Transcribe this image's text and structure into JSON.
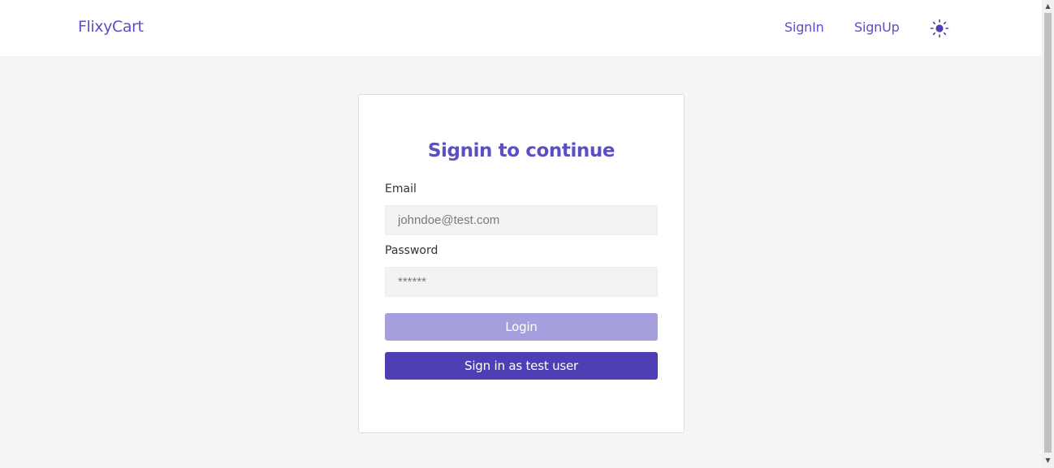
{
  "header": {
    "brand": "FlixyCart",
    "nav": {
      "signin_label": "SignIn",
      "signup_label": "SignUp"
    },
    "theme_toggle_icon": "sun-icon"
  },
  "signin_card": {
    "title": "Signin to continue",
    "email": {
      "label": "Email",
      "value": "",
      "placeholder": "johndoe@test.com"
    },
    "password": {
      "label": "Password",
      "value": "",
      "placeholder": "******"
    },
    "login_button": "Login",
    "test_user_button": "Sign in as test user"
  },
  "colors": {
    "accent": "#5c4fc4",
    "primary_button": "#4e40b4",
    "disabled_button": "#a59fde",
    "page_background": "#f5f5f5"
  }
}
